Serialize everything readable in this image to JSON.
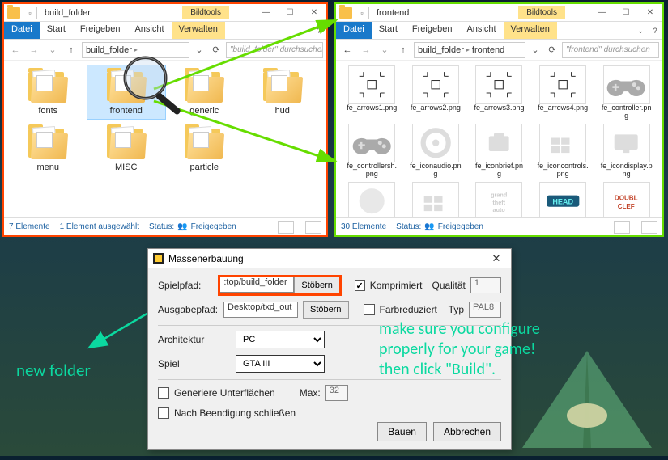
{
  "left_explorer": {
    "title": "build_folder",
    "ribbon_highlight": "Bildtools",
    "tabs": {
      "file": "Datei",
      "start": "Start",
      "share": "Freigeben",
      "view": "Ansicht",
      "manage": "Verwalten"
    },
    "breadcrumb": [
      "build_folder"
    ],
    "search_placeholder": "\"build_folder\" durchsuchen",
    "folders": [
      {
        "name": "fonts"
      },
      {
        "name": "frontend",
        "selected": true
      },
      {
        "name": "generic"
      },
      {
        "name": "hud"
      },
      {
        "name": "menu"
      },
      {
        "name": "MISC"
      },
      {
        "name": "particle"
      }
    ],
    "status_count": "7 Elemente",
    "status_selected": "1 Element ausgewählt",
    "status_share_label": "Status:",
    "status_share_value": "Freigegeben"
  },
  "right_explorer": {
    "title": "frontend",
    "ribbon_highlight": "Bildtools",
    "tabs": {
      "file": "Datei",
      "start": "Start",
      "share": "Freigeben",
      "view": "Ansicht",
      "manage": "Verwalten"
    },
    "breadcrumb": [
      "build_folder",
      "frontend"
    ],
    "search_placeholder": "\"frontend\" durchsuchen",
    "files": [
      "fe_arrows1.png",
      "fe_arrows2.png",
      "fe_arrows3.png",
      "fe_arrows4.png",
      "fe_controller.png",
      "fe_controllersh.png",
      "fe_iconaudio.png",
      "fe_iconbrief.png",
      "fe_iconcontrols.png",
      "fe_icondisplay.png",
      "",
      "",
      "",
      "",
      ""
    ],
    "status_count": "30 Elemente",
    "status_share_label": "Status:",
    "status_share_value": "Freigegeben"
  },
  "dialog": {
    "title": "Massenerbauung",
    "gamepath_label": "Spielpfad:",
    "gamepath_value": ":top/build_folder",
    "outpath_label": "Ausgabepfad:",
    "outpath_value": "Desktop/txd_out",
    "browse": "Stöbern",
    "compressed_label": "Komprimiert",
    "compressed_checked": true,
    "palettized_label": "Farbreduziert",
    "palettized_checked": false,
    "quality_label": "Qualität",
    "quality_value": "1",
    "type_label": "Typ",
    "type_value": "PAL8",
    "arch_label": "Architektur",
    "arch_value": "PC",
    "game_label": "Spiel",
    "game_value": "GTA III",
    "gen_sub_label": "Generiere Unterflächen",
    "max_label": "Max:",
    "max_value": "32",
    "close_after_label": "Nach Beendigung schließen",
    "build_btn": "Bauen",
    "cancel_btn": "Abbrechen"
  },
  "annotations": {
    "new_folder": "new folder",
    "instructions": "make sure you configure\nproperly for your game!\nthen click \"Build\"."
  }
}
